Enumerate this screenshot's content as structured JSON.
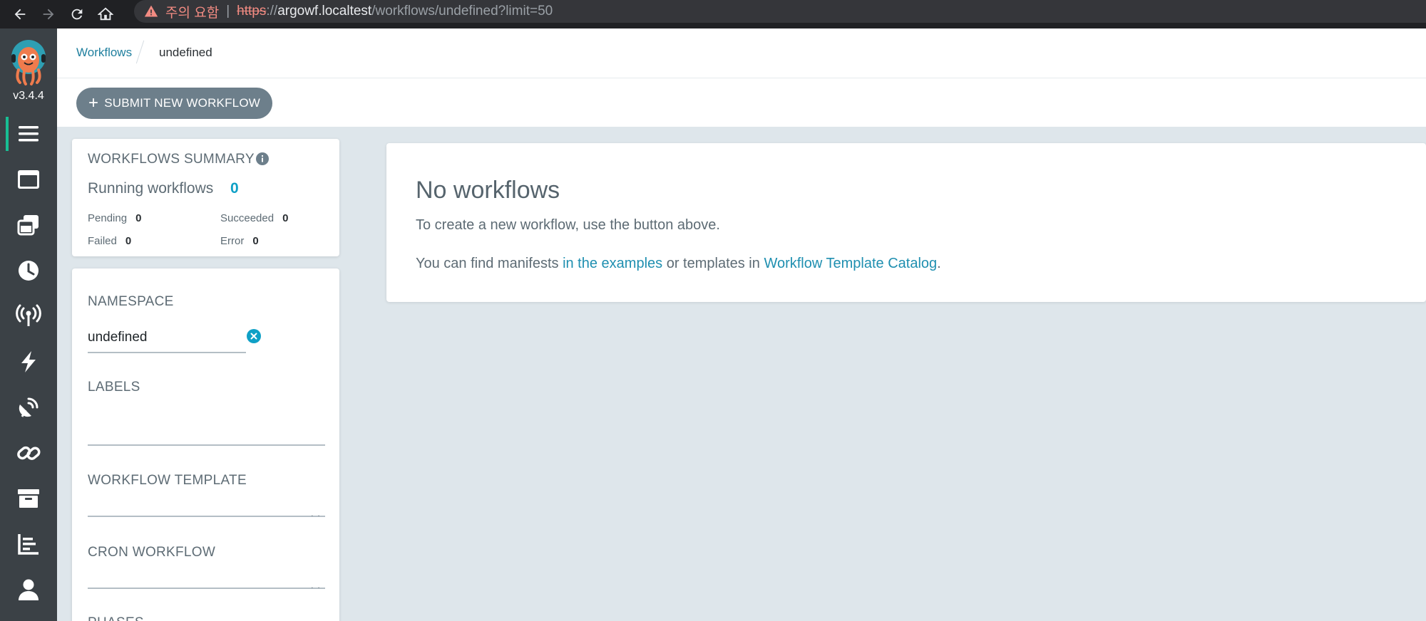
{
  "browser": {
    "warning_text": "주의 요함",
    "url_protocol": "https",
    "url_slashes": "://",
    "url_host": "argowf.localtest",
    "url_path": "/workflows/undefined?limit=50"
  },
  "sidebar": {
    "version": "v3.4.4",
    "items": [
      {
        "icon": "workflows-icon",
        "active": true
      },
      {
        "icon": "workflow-templates-icon"
      },
      {
        "icon": "cluster-templates-icon"
      },
      {
        "icon": "cron-workflows-icon"
      },
      {
        "icon": "event-sources-icon"
      },
      {
        "icon": "sensors-icon"
      },
      {
        "icon": "event-flow-icon"
      },
      {
        "icon": "link-icon"
      },
      {
        "icon": "archived-workflows-icon"
      },
      {
        "icon": "reports-icon"
      },
      {
        "icon": "user-icon"
      }
    ]
  },
  "header": {
    "breadcrumb_link": "Workflows",
    "breadcrumb_current": "undefined"
  },
  "toolbar": {
    "submit_plus": "+",
    "submit_label": "SUBMIT NEW WORKFLOW"
  },
  "summary": {
    "title": "WORKFLOWS SUMMARY",
    "running_label": "Running workflows",
    "running_count": "0",
    "pending_label": "Pending",
    "pending_count": "0",
    "succeeded_label": "Succeeded",
    "succeeded_count": "0",
    "failed_label": "Failed",
    "failed_count": "0",
    "error_label": "Error",
    "error_count": "0"
  },
  "filters": {
    "namespace_label": "NAMESPACE",
    "namespace_value": "undefined",
    "labels_label": "LABELS",
    "workflow_template_label": "WORKFLOW TEMPLATE",
    "cron_workflow_label": "CRON WORKFLOW",
    "phases_label": "PHASES"
  },
  "empty_state": {
    "title": "No workflows",
    "line1": "To create a new workflow, use the button above.",
    "line2_prefix": "You can find manifests ",
    "examples_link": "in the examples",
    "line2_middle": " or templates in ",
    "catalog_link": "Workflow Template Catalog",
    "line2_suffix": "."
  },
  "colors": {
    "accent": "#18be94",
    "link": "#1f8fb0",
    "sidebar_bg": "#3b4146",
    "page_bg": "#dee6eb",
    "button_bg": "#6d7f8b"
  }
}
